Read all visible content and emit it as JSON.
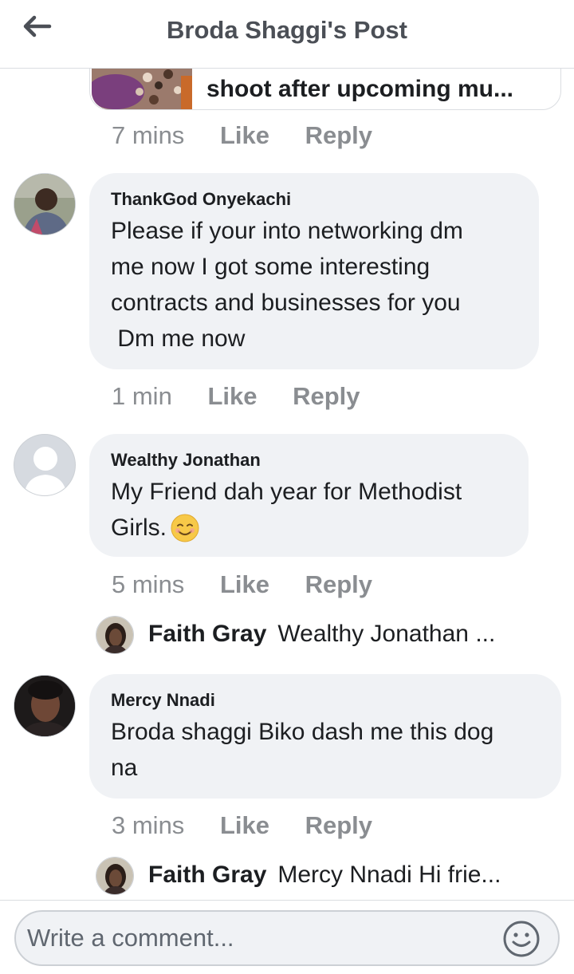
{
  "header": {
    "title": "Broda Shaggi's Post"
  },
  "top_comment": {
    "text": "shoot after upcoming mu...",
    "time": "7 mins",
    "like": "Like",
    "reply": "Reply"
  },
  "comments": [
    {
      "name": "ThankGod Onyekachi",
      "lines": [
        "Please if your into networking dm",
        "me now I got some interesting",
        "contracts and businesses for you",
        " Dm me now"
      ],
      "time": "1 min",
      "like": "Like",
      "reply": "Reply"
    },
    {
      "name": "Wealthy Jonathan",
      "lines": [
        "My Friend dah year for Methodist",
        "Girls."
      ],
      "time": "5 mins",
      "like": "Like",
      "reply": "Reply",
      "reply_preview": {
        "name": "Faith Gray",
        "text": "Wealthy Jonathan ..."
      }
    },
    {
      "name": "Mercy Nnadi",
      "lines": [
        "Broda shaggi Biko dash me this dog",
        "na"
      ],
      "time": "3 mins",
      "like": "Like",
      "reply": "Reply",
      "reply_preview": {
        "name": "Faith Gray",
        "text": "Mercy Nnadi Hi frie..."
      }
    }
  ],
  "composer": {
    "placeholder": "Write a comment..."
  },
  "icons": {
    "back": "arrow-left-icon",
    "emoji": "smile-icon",
    "default_avatar": "person-silhouette-icon"
  },
  "colors": {
    "bubble": "#f0f2f5",
    "meta": "#8a8d91",
    "header_text": "#4b4f56"
  }
}
